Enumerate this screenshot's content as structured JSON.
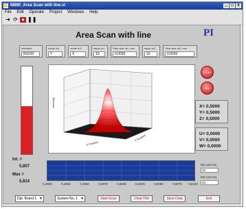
{
  "window": {
    "title": "M880_Area Scan with line.vi"
  },
  "menu": [
    "File",
    "Edit",
    "Operate",
    "Project",
    "Windows",
    "Help"
  ],
  "header": {
    "title": "Area Scan with line",
    "logo": "PI"
  },
  "params": [
    {
      "label": "Interface",
      "value": "RS232"
    },
    {
      "label": "mode m1",
      "value": "Y"
    },
    {
      "label": "mode m2",
      "value": "X"
    },
    {
      "label": "steps m1",
      "value": "10"
    },
    {
      "label": "Step size m1, mm",
      "value": "0,0020"
    },
    {
      "label": "steps m2",
      "value": "10"
    },
    {
      "label": "Step size m2, mm",
      "value": "0,0020"
    }
  ],
  "plot": {
    "axis_x": "X Position",
    "axis_y": "Y Position",
    "axis_z": "Intensity"
  },
  "gauge": {
    "level": 0.55
  },
  "intensity": {
    "int_label": "Int. =",
    "int_value": "5,807",
    "max_label": "Max =",
    "max_value": "5,814"
  },
  "buttons": {
    "scan": "SCAN",
    "stop": "Stop",
    "start_scan": "Start Scan",
    "clear_plot": "Clear Plot",
    "save_data": "Save Data",
    "exit": "Exit"
  },
  "coords_xyz": [
    "X= 0,5000",
    "Y= 0,5000",
    "Z= 0,5000"
  ],
  "coords_uvw": [
    "U= 0,0000",
    "V= 0,0000",
    "W= 0,0000"
  ],
  "line_axis": [
    "0,4900",
    "0,4925",
    "0,4950",
    "0,4975",
    "0,5000",
    "0,5025",
    "0,5050",
    "0,5075",
    "0,5100"
  ],
  "line_nos": [
    {
      "label": "M1 Line No.",
      "value": "10"
    },
    {
      "label": "M2 Line No.",
      "value": "10"
    }
  ],
  "selectors": {
    "board": "Dpt. Board 1",
    "system": "System No. 1"
  }
}
